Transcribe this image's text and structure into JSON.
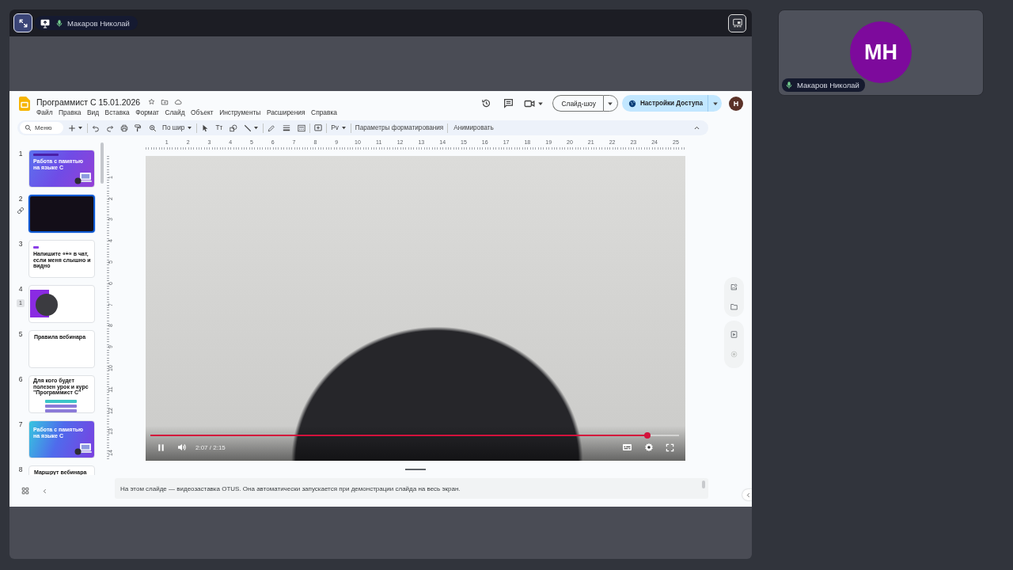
{
  "meeting": {
    "top_bar": {
      "presenter": {
        "name": "Макаров Николай",
        "muted": false
      }
    }
  },
  "slides_app": {
    "title": "Программист C 15.01.2026",
    "menu": [
      "Файл",
      "Правка",
      "Вид",
      "Вставка",
      "Формат",
      "Слайд",
      "Объект",
      "Инструменты",
      "Расширения",
      "Справка"
    ],
    "header": {
      "slideshow": "Слайд-шоу",
      "share": "Настройки Доступа",
      "avatar": "Н"
    },
    "toolbar": {
      "search": {
        "placeholder": "Меню"
      },
      "zoom": "По шир",
      "text_tool": "Tт",
      "replace": "Pv",
      "format_options": "Параметры форматирования",
      "animate": "Анимировать"
    },
    "slides": [
      {
        "number": "1",
        "kind": "cover",
        "title": "Работа с памятью на языке C",
        "selected": false,
        "linked": false
      },
      {
        "number": "2",
        "kind": "dark",
        "selected": true,
        "linked": true
      },
      {
        "number": "3",
        "kind": "tagged",
        "title": "Напишите «+» в чат, если меня слышно и видно",
        "selected": false,
        "linked": false
      },
      {
        "number": "4",
        "kind": "speaker",
        "badge": "1",
        "selected": false,
        "linked": false
      },
      {
        "number": "5",
        "kind": "text",
        "title": "Правила вебинара",
        "selected": false,
        "linked": false
      },
      {
        "number": "6",
        "kind": "options",
        "title": "Для кого будет полезен урок и курс \"Программист C\"",
        "selected": false,
        "linked": false
      },
      {
        "number": "7",
        "kind": "section",
        "title": "Работа с памятью на языке C",
        "selected": false,
        "linked": false
      },
      {
        "number": "8",
        "kind": "text",
        "title": "Маршрут вебинара",
        "selected": false,
        "linked": false
      }
    ],
    "ruler": {
      "horizontal": [
        "1",
        "2",
        "3",
        "4",
        "5",
        "6",
        "7",
        "8",
        "9",
        "10",
        "11",
        "12",
        "13",
        "14",
        "15",
        "16",
        "17",
        "18",
        "19",
        "20",
        "21",
        "22",
        "23",
        "24",
        "25"
      ],
      "vertical": [
        "1",
        "2",
        "3",
        "4",
        "5",
        "6",
        "7",
        "8",
        "9",
        "10",
        "11",
        "12",
        "13",
        "14"
      ]
    },
    "video": {
      "playing": true,
      "muted": false,
      "time": "2:07 / 2:15",
      "level": 0.94
    },
    "speaker_notes": "На этом слайде — видеозаставка OTUS. Она автоматически запускается при демонстрации слайда на весь экран."
  },
  "participant": {
    "initials": "МН",
    "name": "Макаров Николай",
    "muted": false
  }
}
